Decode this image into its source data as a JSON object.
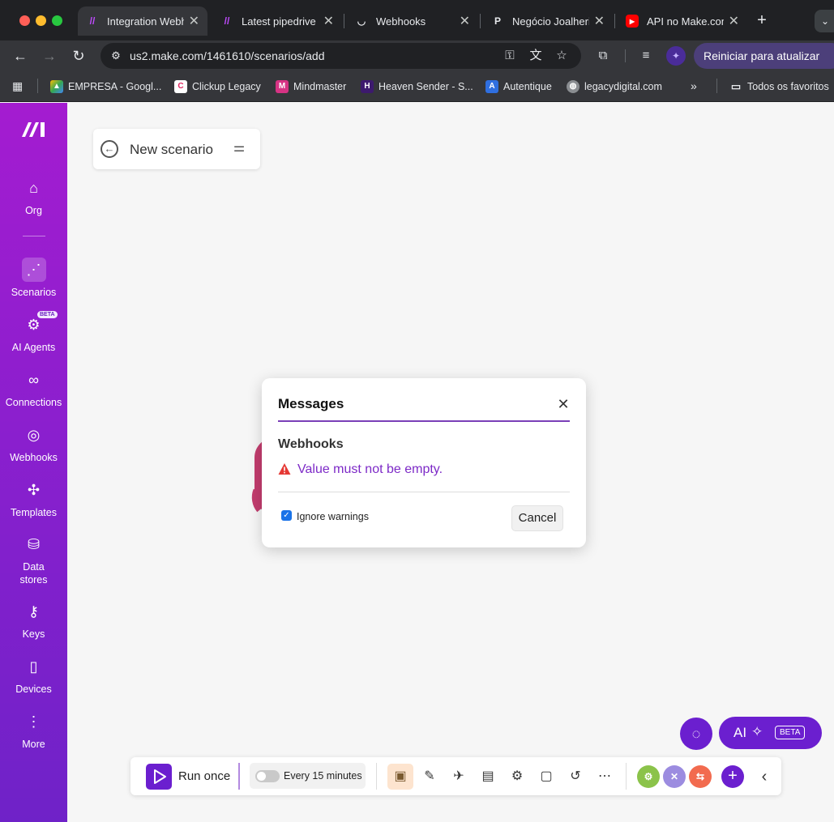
{
  "browser": {
    "tabs": [
      {
        "title": "Integration Webh",
        "favicon": "make-logo",
        "color": "#a020f0"
      },
      {
        "title": "Latest pipedrive",
        "favicon": "make-logo",
        "color": "#a020f0"
      },
      {
        "title": "Webhooks",
        "favicon": "webhooks-logo",
        "color": "#ffffff"
      },
      {
        "title": "Negócio Joalheri",
        "favicon": "pipedrive-logo",
        "color": "#ffffff"
      },
      {
        "title": "API no Make.com",
        "favicon": "youtube-logo",
        "color": "#ff0000"
      }
    ],
    "url": "us2.make.com/1461610/scenarios/add",
    "update_button": "Reiniciar para atualizar",
    "bookmarks": [
      {
        "label": "EMPRESA - Googl...",
        "icon": "google-drive-icon"
      },
      {
        "label": "Clickup Legacy",
        "icon": "clickup-icon"
      },
      {
        "label": "Mindmaster",
        "icon": "mindmaster-icon"
      },
      {
        "label": "Heaven Sender - S...",
        "icon": "heaven-sender-icon"
      },
      {
        "label": "Autentique",
        "icon": "autentique-icon"
      },
      {
        "label": "legacydigital.com",
        "icon": "globe-icon"
      }
    ],
    "all_bookmarks": "Todos os favoritos"
  },
  "sidebar": {
    "items": [
      {
        "label": "Org",
        "icon": "home-icon"
      },
      {
        "label": "Scenarios",
        "icon": "share-nodes-icon",
        "active": true
      },
      {
        "label": "AI Agents",
        "icon": "ai-agent-icon",
        "badge": "BETA"
      },
      {
        "label": "Connections",
        "icon": "link-icon"
      },
      {
        "label": "Webhooks",
        "icon": "globe-icon"
      },
      {
        "label": "Templates",
        "icon": "puzzle-icon"
      },
      {
        "label": "Data\nstores",
        "icon": "database-icon"
      },
      {
        "label": "Keys",
        "icon": "key-icon"
      },
      {
        "label": "Devices",
        "icon": "phone-icon"
      },
      {
        "label": "More",
        "icon": "more-vertical-icon"
      }
    ]
  },
  "scenario": {
    "name": "New scenario"
  },
  "dialog": {
    "title": "Messages",
    "section": "Webhooks",
    "warning": "Value must not be empty.",
    "ignore_label": "Ignore warnings",
    "ignore_checked": true,
    "cancel": "Cancel"
  },
  "floating": {
    "ai_label": "AI",
    "ai_badge": "BETA"
  },
  "bottombar": {
    "run_label": "Run once",
    "schedule_label": "Every 15 minutes",
    "schedule_enabled": false,
    "app_badges": [
      {
        "icon": "gear-app-icon",
        "color": "#8bc34a"
      },
      {
        "icon": "tools-app-icon",
        "color": "#9c8ce0"
      },
      {
        "icon": "flow-control-icon",
        "color": "#f26b4f"
      }
    ]
  },
  "colors": {
    "accent": "#6b1fcf",
    "warning_text": "#7d2ac7",
    "warning_icon": "#e53935"
  }
}
